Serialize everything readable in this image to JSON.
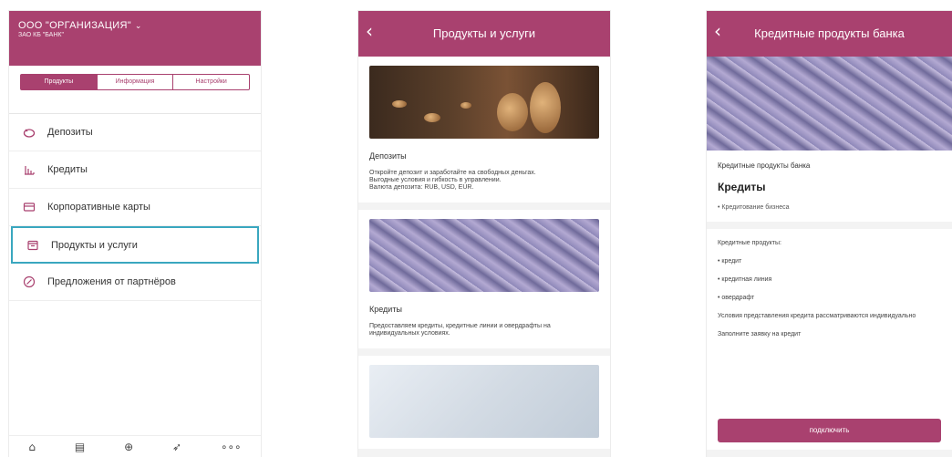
{
  "screen1": {
    "org_name": "ООО \"ОРГАНИЗАЦИЯ\"",
    "bank_name": "ЗАО КБ \"БАНК\"",
    "tabs": [
      "Продукты",
      "Информация",
      "Настройки"
    ],
    "menu": [
      {
        "label": "Депозиты",
        "icon": "piggy-bank-icon"
      },
      {
        "label": "Кредиты",
        "icon": "chart-icon"
      },
      {
        "label": "Корпоративные карты",
        "icon": "card-icon"
      },
      {
        "label": "Продукты и услуги",
        "icon": "box-icon"
      },
      {
        "label": "Предложения от партнёров",
        "icon": "percent-icon"
      }
    ],
    "bottom_nav": [
      "home-icon",
      "document-icon",
      "plus-circle-icon",
      "send-icon",
      "more-icon"
    ],
    "accent": "#a9416f",
    "highlight": "#3aa7bf"
  },
  "screen2": {
    "title": "Продукты и услуги",
    "cards": [
      {
        "title": "Депозиты",
        "text": "Откройте депозит и заработайте на свободных деньгах.\nВыгодные условия и гибкость в управлении.\nВалюта депозита: RUB, USD, EUR."
      },
      {
        "title": "Кредиты",
        "text": "Предоставляем кредиты, кредитные линии и овердрафты на индивидуальных условиях."
      }
    ]
  },
  "screen3": {
    "title": "Кредитные продукты банка",
    "label": "Кредитные продукты банка",
    "heading": "Кредиты",
    "sub": "• Кредитование бизнеса",
    "items": [
      "Кредитные продукты:",
      "• кредит",
      "• кредитная линия",
      "• овердрафт",
      "Условия представления кредита рассматриваются индивидуально",
      "Заполните заявку на кредит"
    ],
    "button": "подключить"
  }
}
